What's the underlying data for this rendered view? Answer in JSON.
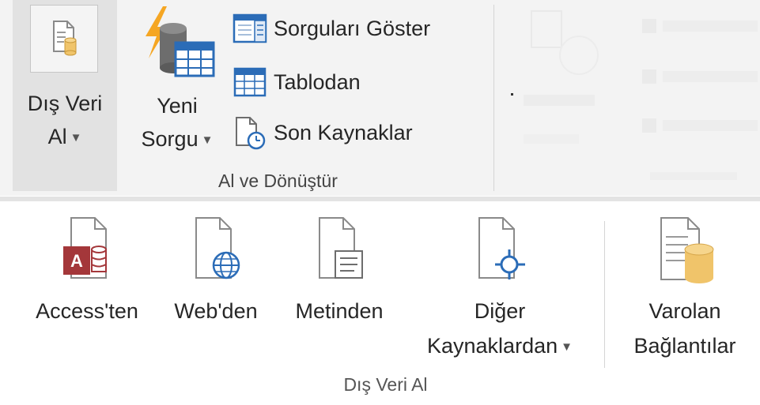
{
  "ribbon": {
    "get_data": {
      "line1": "Dış Veri",
      "line2": "Al"
    },
    "new_query": {
      "line1": "Yeni",
      "line2": "Sorgu"
    },
    "show_queries": "Sorguları Göster",
    "from_table": "Tablodan",
    "recent_sources": "Son Kaynaklar",
    "group_label": "Al ve Dönüştür"
  },
  "dropdown": {
    "buttons": [
      {
        "label1": "Access'ten",
        "label2": ""
      },
      {
        "label1": "Web'den",
        "label2": ""
      },
      {
        "label1": "Metinden",
        "label2": ""
      },
      {
        "label1": "Diğer",
        "label2": "Kaynaklardan"
      },
      {
        "label1": "Varolan",
        "label2": "Bağlantılar"
      }
    ],
    "group_label": "Dış Veri Al"
  },
  "icons": {
    "get_data": "database-document-icon",
    "new_query": "lightning-database-icon",
    "show_queries": "query-pane-icon",
    "from_table": "table-icon",
    "recent_sources": "recent-document-icon",
    "access": "access-icon",
    "web": "web-document-icon",
    "text": "text-document-icon",
    "other": "other-sources-icon",
    "existing": "existing-connections-icon"
  },
  "colors": {
    "ribbon_bg": "#f3f3f3",
    "pressed_bg": "#e2e2e2",
    "access_red": "#a4373a",
    "database_gold": "#f0c46a",
    "web_blue": "#2b6cb7",
    "lightning_orange": "#f5a623"
  }
}
